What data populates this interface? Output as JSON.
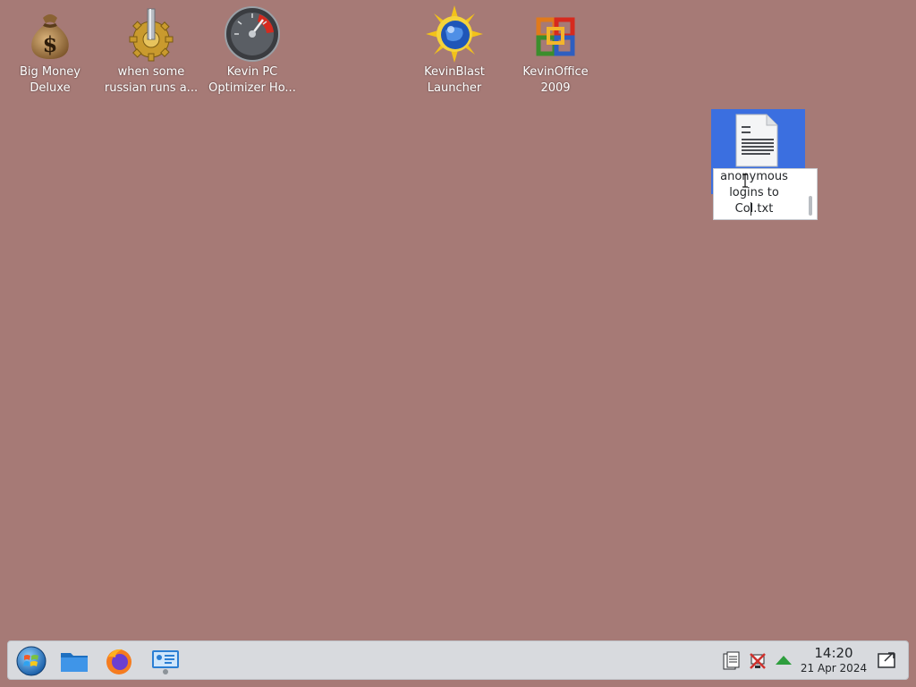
{
  "desktop": {
    "background_color": "#a67a76",
    "icons": [
      {
        "name": "money-bag-icon",
        "label": "Big Money\nDeluxe"
      },
      {
        "name": "gear-icon",
        "label": "when some\nrussian runs a..."
      },
      {
        "name": "speedometer-icon",
        "label": "Kevin PC\nOptimizer Ho..."
      },
      {
        "name": "globe-sun-icon",
        "label": "KevinBlast\nLauncher"
      },
      {
        "name": "office-logo-icon",
        "label": "KevinOffice\n2009"
      }
    ],
    "selected_file": {
      "icon": "text-document-icon",
      "rename_value": "anonymous\nlogins to\nCol.txt"
    }
  },
  "taskbar": {
    "start": {
      "icon": "start-orb-icon"
    },
    "launchers": [
      {
        "icon": "folder-icon"
      },
      {
        "icon": "firefox-icon"
      },
      {
        "icon": "system-monitor-icon"
      }
    ],
    "tray": [
      {
        "icon": "clipboard-icon"
      },
      {
        "icon": "network-disconnected-icon"
      },
      {
        "icon": "updates-arrow-icon"
      }
    ],
    "clock": {
      "time": "14:20",
      "date": "21 Apr 2024"
    },
    "show_desktop": {
      "icon": "show-desktop-icon"
    }
  }
}
